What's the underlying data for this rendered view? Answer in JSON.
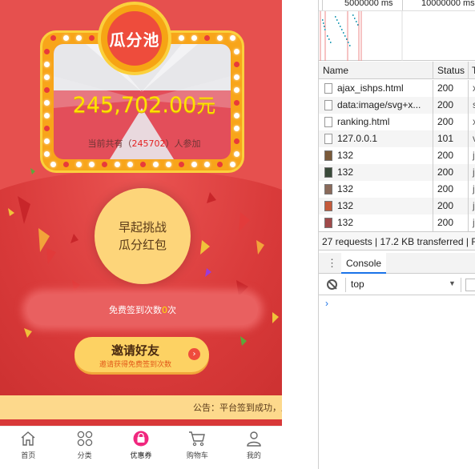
{
  "page": {
    "pool": {
      "title": "瓜分池",
      "amount": "245,702.00",
      "currency": "元",
      "participants_prefix": "当前共有（",
      "participants_count": "245702",
      "participants_suffix": "）人参加"
    },
    "challenge": {
      "line1": "早起挑战",
      "line2": "瓜分红包"
    },
    "signin": {
      "prefix": "免费签到次数",
      "count": "0",
      "suffix": "次"
    },
    "invite": {
      "title": "邀请好友",
      "subtitle": "邀请获得免费签到次数"
    },
    "notice": "公告：平台签到成功，瓜分",
    "tabs": [
      {
        "label": "首页",
        "icon": "home-icon"
      },
      {
        "label": "分类",
        "icon": "category-icon"
      },
      {
        "label": "优惠券",
        "icon": "coupon-icon"
      },
      {
        "label": "购物车",
        "icon": "cart-icon"
      },
      {
        "label": "我的",
        "icon": "user-icon"
      }
    ],
    "colors": {
      "brand_red": "#d83838",
      "gold": "#f8a51a",
      "amount_yellow": "#ffe000",
      "coupon_pink": "#f0277e"
    }
  },
  "devtools": {
    "timeline_ticks": [
      "5000000 ms",
      "10000000 ms"
    ],
    "columns": {
      "name": "Name",
      "status": "Status",
      "type": "T"
    },
    "requests": [
      {
        "name": "ajax_ishps.html",
        "status": "200",
        "type": "x"
      },
      {
        "name": "data:image/svg+x...",
        "status": "200",
        "type": "s"
      },
      {
        "name": "ranking.html",
        "status": "200",
        "type": "x"
      },
      {
        "name": "127.0.0.1",
        "status": "101",
        "type": "v"
      },
      {
        "name": "132",
        "status": "200",
        "type": "jp"
      },
      {
        "name": "132",
        "status": "200",
        "type": "jp"
      },
      {
        "name": "132",
        "status": "200",
        "type": "jp"
      },
      {
        "name": "132",
        "status": "200",
        "type": "jp"
      },
      {
        "name": "132",
        "status": "200",
        "type": "jp"
      }
    ],
    "summary": "27 requests | 17.2 KB transferred | F",
    "console_tab": "Console",
    "context": "top",
    "prompt": "›"
  }
}
